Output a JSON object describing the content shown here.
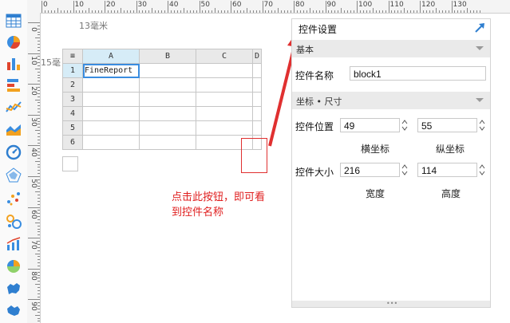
{
  "ruler": {
    "top_labels": [
      "0",
      "10",
      "20",
      "30",
      "40",
      "50",
      "60",
      "70",
      "80",
      "90",
      "100",
      "110",
      "120",
      "130"
    ],
    "left_labels": [
      "0",
      "10",
      "20",
      "30",
      "40",
      "50",
      "60",
      "70",
      "80",
      "90"
    ],
    "mm_top": "13毫米",
    "mm_left": "15毫"
  },
  "grid": {
    "corner": "≡",
    "columns": [
      "A",
      "B",
      "C",
      "D"
    ],
    "rows": [
      "1",
      "2",
      "3",
      "4",
      "5",
      "6"
    ],
    "cell_a1": "FineReport"
  },
  "annotation": {
    "line1": "点击此按钮，即可看",
    "line2": "到控件名称"
  },
  "panel": {
    "title": "控件设置",
    "section_basic": "基本",
    "name_label": "控件名称",
    "name_value": "block1",
    "section_coords": "坐标 • 尺寸",
    "position_label": "控件位置",
    "pos_x": "49",
    "pos_y": "55",
    "x_caption": "横坐标",
    "y_caption": "纵坐标",
    "size_label": "控件大小",
    "width_value": "216",
    "height_value": "114",
    "width_caption": "宽度",
    "height_caption": "高度",
    "grip": "•••"
  },
  "colors": {
    "accent": "#3a8de0",
    "annotation": "#e02020"
  }
}
